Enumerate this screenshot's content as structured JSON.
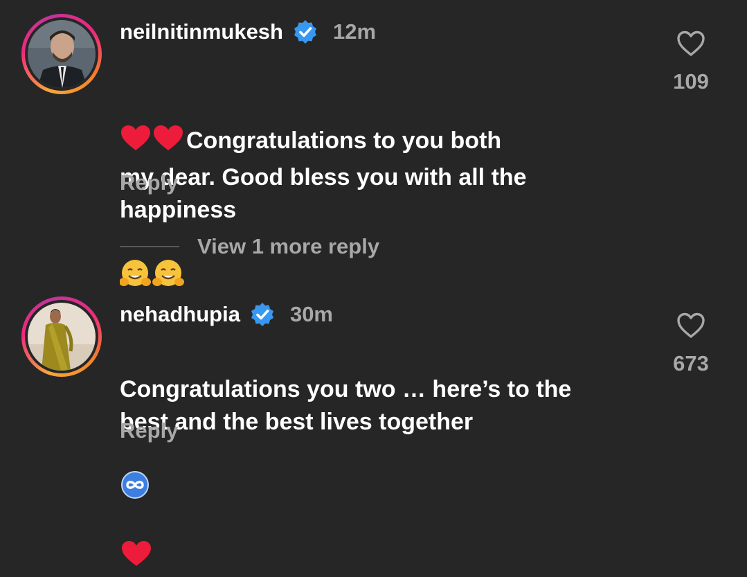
{
  "comments": [
    {
      "username": "neilnitinmukesh",
      "time": "12m",
      "text_before": "Congratulations to you both\nmy dear. Good bless you with all the\nhappiness",
      "leading_emoji": "heart-heart",
      "trailing_emoji": "hugging-face-x2",
      "reply_label": "Reply",
      "like_count": "109",
      "verified": true
    },
    {
      "username": "nehadhupia",
      "time": "30m",
      "text_before": "Congratulations you two … here’s to the\nbest and the best lives together",
      "trailing_emoji": "infinity-heart",
      "reply_label": "Reply",
      "like_count": "673",
      "verified": true
    }
  ],
  "view_more": {
    "label": "View 1 more reply"
  },
  "colors": {
    "background": "#262626",
    "secondary_text": "#a8a8a8",
    "verified_blue": "#3897f0",
    "heart_red": "#ed1c3a"
  },
  "icons": {
    "like": "heart-outline-icon",
    "verified": "verified-badge-icon"
  }
}
